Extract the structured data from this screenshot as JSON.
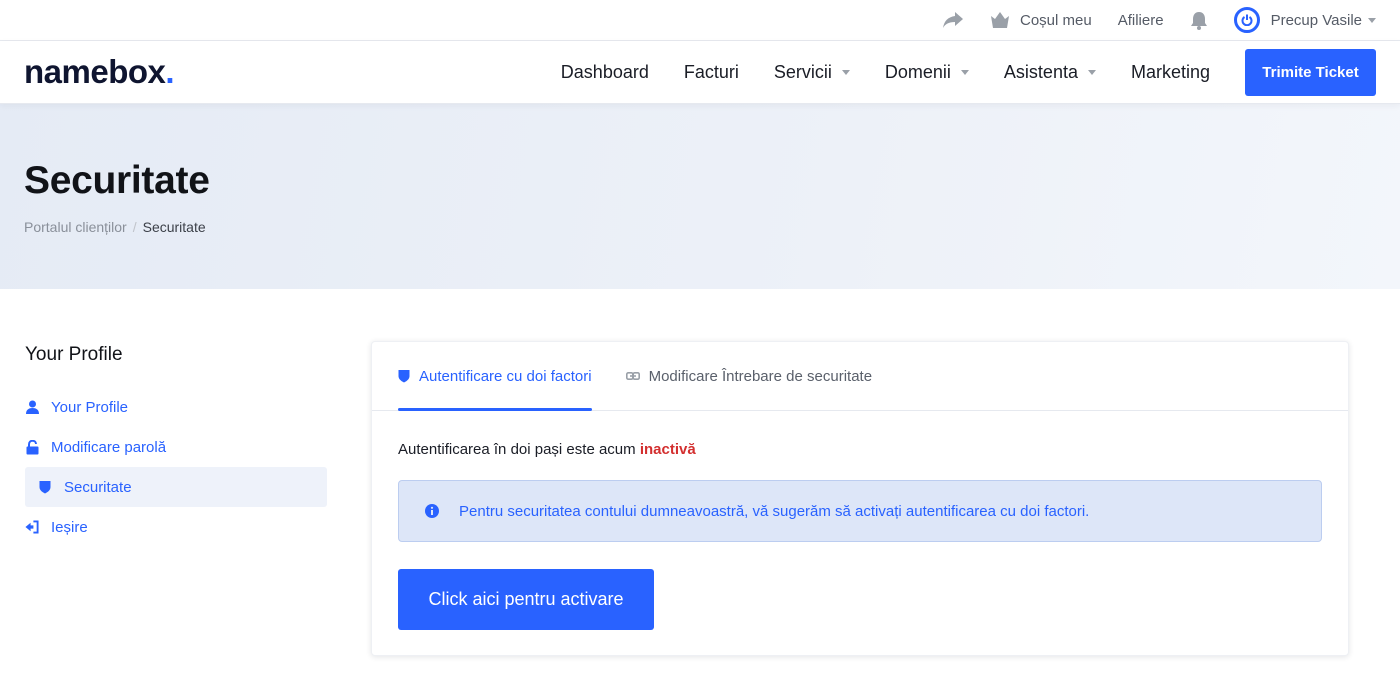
{
  "topbar": {
    "cart_label": "Coșul meu",
    "affiliate_label": "Afiliere",
    "user_name": "Precup Vasile"
  },
  "navbar": {
    "logo_text": "namebox",
    "logo_dot": ".",
    "items": [
      {
        "label": "Dashboard",
        "dropdown": false
      },
      {
        "label": "Facturi",
        "dropdown": false
      },
      {
        "label": "Servicii",
        "dropdown": true
      },
      {
        "label": "Domenii",
        "dropdown": true
      },
      {
        "label": "Asistenta",
        "dropdown": true
      },
      {
        "label": "Marketing",
        "dropdown": false
      }
    ],
    "ticket_button": "Trimite Ticket"
  },
  "hero": {
    "title": "Securitate",
    "breadcrumb": {
      "home": "Portalul clienților",
      "separator": "/",
      "current": "Securitate"
    }
  },
  "sidebar": {
    "title": "Your Profile",
    "items": [
      {
        "label": "Your Profile",
        "icon": "user-icon"
      },
      {
        "label": "Modificare parolă",
        "icon": "lock-icon"
      },
      {
        "label": "Securitate",
        "icon": "shield-icon",
        "active": true
      },
      {
        "label": "Ieșire",
        "icon": "sign-out-icon"
      }
    ]
  },
  "card": {
    "tabs": [
      {
        "label": "Autentificare cu doi factori",
        "icon": "shield-icon",
        "active": true
      },
      {
        "label": "Modificare Întrebare de securitate",
        "icon": "link-icon",
        "active": false
      }
    ],
    "status_text": "Autentificarea în doi pași este acum",
    "status_value": "inactivă",
    "alert_text": "Pentru securitatea contului dumneavoastră, vă sugerăm să activați autentificarea cu doi factori.",
    "activate_button": "Click aici pentru activare"
  },
  "colors": {
    "accent": "#2962ff",
    "inactive": "#d32f2f",
    "alert_bg": "#dde6f8"
  }
}
